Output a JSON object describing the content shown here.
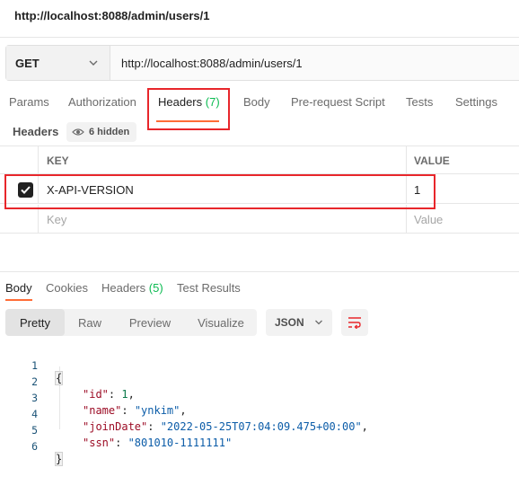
{
  "window": {
    "title_url": "http://localhost:8088/admin/users/1"
  },
  "request": {
    "method": "GET",
    "url": "http://localhost:8088/admin/users/1"
  },
  "request_tabs": [
    {
      "label": "Params"
    },
    {
      "label": "Authorization"
    },
    {
      "label": "Headers",
      "count": "(7)",
      "active": true
    },
    {
      "label": "Body"
    },
    {
      "label": "Pre-request Script"
    },
    {
      "label": "Tests"
    },
    {
      "label": "Settings"
    }
  ],
  "headers_section": {
    "title": "Headers",
    "hidden_label": "6 hidden"
  },
  "headers_table": {
    "columns": [
      "KEY",
      "VALUE"
    ],
    "rows": [
      {
        "checked": true,
        "key": "X-API-VERSION",
        "value": "1"
      }
    ],
    "placeholder": {
      "key": "Key",
      "value": "Value"
    }
  },
  "response_tabs": [
    {
      "label": "Body",
      "active": true
    },
    {
      "label": "Cookies"
    },
    {
      "label": "Headers",
      "count": "(5)"
    },
    {
      "label": "Test Results"
    }
  ],
  "view_modes": [
    "Pretty",
    "Raw",
    "Preview",
    "Visualize"
  ],
  "format": "JSON",
  "response_body": {
    "line_numbers": [
      "1",
      "2",
      "3",
      "4",
      "5",
      "6"
    ],
    "open": "{",
    "close": "}",
    "fields": [
      {
        "key": "\"id\"",
        "sep": ": ",
        "value": "1",
        "type": "number",
        "trail": ","
      },
      {
        "key": "\"name\"",
        "sep": ": ",
        "value": "\"ynkim\"",
        "type": "string",
        "trail": ","
      },
      {
        "key": "\"joinDate\"",
        "sep": ": ",
        "value": "\"2022-05-25T07:04:09.475+00:00\"",
        "type": "string",
        "trail": ","
      },
      {
        "key": "\"ssn\"",
        "sep": ": ",
        "value": "\"801010-1111111\"",
        "type": "string",
        "trail": ""
      }
    ]
  },
  "colors": {
    "accent": "#ff6c37",
    "highlight_box": "#e8262b",
    "count_green": "#0cbb52"
  }
}
